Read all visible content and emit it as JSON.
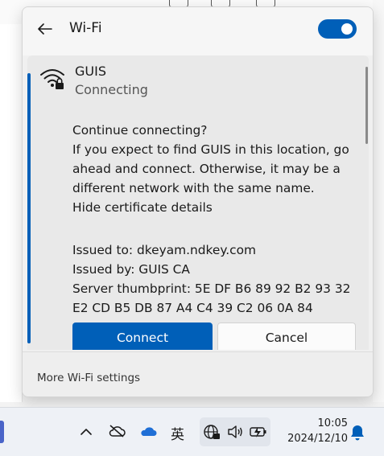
{
  "flyout": {
    "title": "Wi-Fi",
    "wifi_enabled": true,
    "network": {
      "name": "GUIS",
      "status": "Connecting",
      "icon": "secured-wifi-icon"
    },
    "prompt_lines": [
      "Continue connecting?",
      "If you expect to find GUIS in this location, go",
      "ahead and connect. Otherwise, it may be a",
      "different network with the same name."
    ],
    "hide_details_link": "Hide certificate details",
    "certificate": {
      "issued_to": "Issued to: dkeyam.ndkey.com",
      "issued_by": "Issued by: GUIS CA",
      "thumbprint_line1": "Server thumbprint: 5E DF B6 89 92 B2 93 32",
      "thumbprint_line2": "E2 CD B5 DB 87 A4 C4 39 C2 06 0A 84"
    },
    "connect_label": "Connect",
    "cancel_label": "Cancel",
    "more_settings_label": "More Wi-Fi settings",
    "accent_color": "#005fb8"
  },
  "taskbar": {
    "ime_label": "英",
    "time": "10:05",
    "date": "2024/12/10",
    "tray_icons": [
      "chevron-up-icon",
      "cloud-offline-icon",
      "onedrive-icon",
      "vpn-globe-icon",
      "speaker-icon",
      "battery-charging-icon",
      "notification-bell-icon"
    ]
  }
}
